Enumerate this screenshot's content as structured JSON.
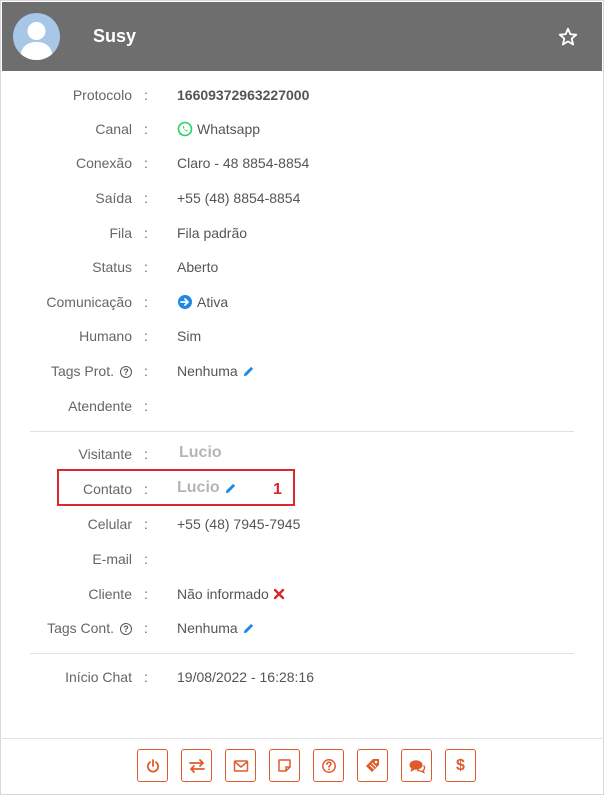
{
  "header": {
    "name": "Susy"
  },
  "protocol_rows": [
    {
      "label": "Protocolo",
      "value": "16609372963227000"
    },
    {
      "label": "Canal",
      "value": "Whatsapp"
    },
    {
      "label": "Conexão",
      "value": "Claro - 48 8854-8854"
    },
    {
      "label": "Saída",
      "value": "+55 (48) 8854-8854"
    },
    {
      "label": "Fila",
      "value": "Fila padrão"
    },
    {
      "label": "Status",
      "value": "Aberto"
    },
    {
      "label": "Comunicação",
      "value": "Ativa"
    },
    {
      "label": "Humano",
      "value": "Sim"
    },
    {
      "label": "Tags Prot.",
      "value": "Nenhuma"
    },
    {
      "label": "Atendente",
      "value": ""
    }
  ],
  "contact_rows": [
    {
      "label": "Visitante",
      "value": "Lucio"
    },
    {
      "label": "Contato",
      "value": "Lucio"
    },
    {
      "label": "Celular",
      "value": "+55 (48) 7945-7945"
    },
    {
      "label": "E-mail",
      "value": ""
    },
    {
      "label": "Cliente",
      "value": "Não informado"
    },
    {
      "label": "Tags Cont.",
      "value": "Nenhuma"
    }
  ],
  "chat_rows": [
    {
      "label": "Início Chat",
      "value": "19/08/2022 - 16:28:16"
    }
  ],
  "separator": ":",
  "help_glyph": "?",
  "annotation": {
    "marker": "1"
  },
  "colors": {
    "header_bg": "#6e6e6e",
    "accent_orange": "#e05a2b",
    "highlight_red": "#d9272e",
    "whatsapp_green": "#25d366",
    "link_blue": "#1e88e5"
  },
  "footer": {
    "buttons": [
      {
        "icon": "power-icon"
      },
      {
        "icon": "transfer-icon"
      },
      {
        "icon": "email-icon"
      },
      {
        "icon": "note-icon"
      },
      {
        "icon": "help-icon"
      },
      {
        "icon": "tag-icon"
      },
      {
        "icon": "chat-icon"
      },
      {
        "icon": "dollar-icon",
        "label": "$"
      }
    ]
  }
}
